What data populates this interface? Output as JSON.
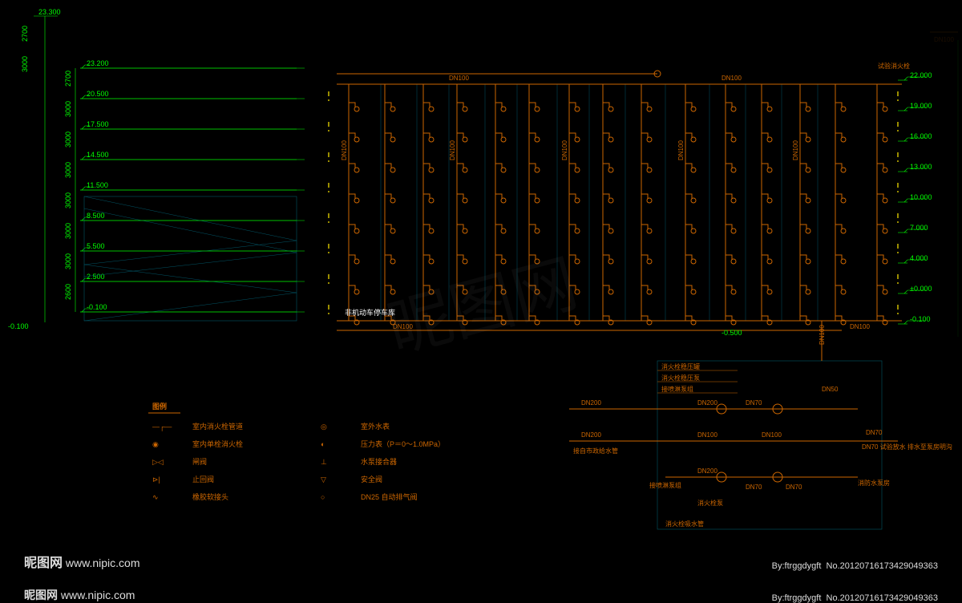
{
  "drawing": {
    "type": "CAD Fire Hydrant System Diagram",
    "pipe_spec": "DN100",
    "sub_pipes": [
      "DN200",
      "DN100",
      "DN70",
      "DN50"
    ],
    "note_garage": "非机动车停车库",
    "note_outside": "-0.500",
    "top_right_note": "试验消火栓",
    "pump_room": {
      "labels": [
        "消火栓稳压罐",
        "消火栓稳压泵",
        "接喷淋泵组",
        "接自市政给水管",
        "接喷淋泵组",
        "消防水泵房",
        "消火栓泵",
        "消火栓吸水管"
      ],
      "pipes": [
        "DN200",
        "DN70",
        "DN100",
        "DN100",
        "DN200",
        "DN100",
        "DN100",
        "DN200",
        "DN70",
        "DN70"
      ],
      "drain": "DN70 试验放水 排水至泵房明沟"
    }
  },
  "elevations_left": [
    {
      "label": "23.200",
      "dim": ""
    },
    {
      "label": "20.500",
      "dim": "2700"
    },
    {
      "label": "17.500",
      "dim": "3000"
    },
    {
      "label": "14.500",
      "dim": "3000"
    },
    {
      "label": "11.500",
      "dim": "3000"
    },
    {
      "label": "8.500",
      "dim": "3000"
    },
    {
      "label": "5.500",
      "dim": "3000"
    },
    {
      "label": "2.500",
      "dim": "3000"
    },
    {
      "label": "-0.100",
      "dim": "2600"
    }
  ],
  "elevations_right": [
    {
      "label": "22.000"
    },
    {
      "label": "19.000"
    },
    {
      "label": "16.000"
    },
    {
      "label": "13.000"
    },
    {
      "label": "10.000"
    },
    {
      "label": "7.000"
    },
    {
      "label": "4.000"
    },
    {
      "label": "±0.000"
    },
    {
      "label": "-0.100"
    }
  ],
  "outer_dims": {
    "top": "23.300",
    "left_stack": [
      "2700",
      "3000",
      "3000",
      "3000",
      "3000",
      "3000",
      "3000",
      "3000",
      "2600"
    ],
    "left_base": "-0.100"
  },
  "legend": {
    "title": "图例",
    "items": [
      {
        "sym": "—┌—",
        "label": "室内消火栓管道"
      },
      {
        "sym": "◉",
        "label": "室内单栓消火栓"
      },
      {
        "sym": "▷◁",
        "label": "闸阀"
      },
      {
        "sym": "⊳|",
        "label": "止回阀"
      },
      {
        "sym": "∿",
        "label": "橡胶软接头"
      },
      {
        "sym": "◎",
        "label": "室外水表"
      },
      {
        "sym": "◐",
        "label": "压力表（P＝0～1.0MPa）"
      },
      {
        "sym": "⊥",
        "label": "水泵接合器"
      },
      {
        "sym": "▽",
        "label": "安全阀"
      },
      {
        "sym": "○",
        "label": "DN25 自动排气阀"
      }
    ]
  },
  "watermark": {
    "site": "昵图网",
    "url": "www.nipic.com",
    "by": "By:ftrggdygft",
    "no": "No.20120716173429049363"
  }
}
